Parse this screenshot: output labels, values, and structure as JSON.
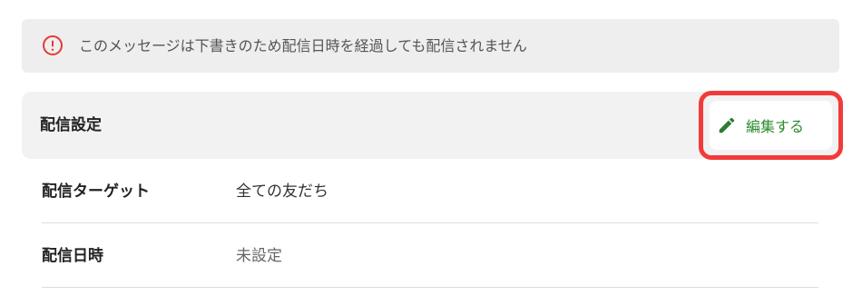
{
  "alert": {
    "icon": "exclamation-circle-icon",
    "text": "このメッセージは下書きのため配信日時を経過しても配信されません",
    "color": "#e53935"
  },
  "section": {
    "title": "配信設定",
    "edit_button": {
      "icon": "pencil-icon",
      "label": "編集する",
      "color": "#2e8b2e"
    },
    "highlight_color": "#f23a3a"
  },
  "rows": [
    {
      "label": "配信ターゲット",
      "value": "全ての友だち"
    },
    {
      "label": "配信日時",
      "value": "未設定"
    }
  ]
}
